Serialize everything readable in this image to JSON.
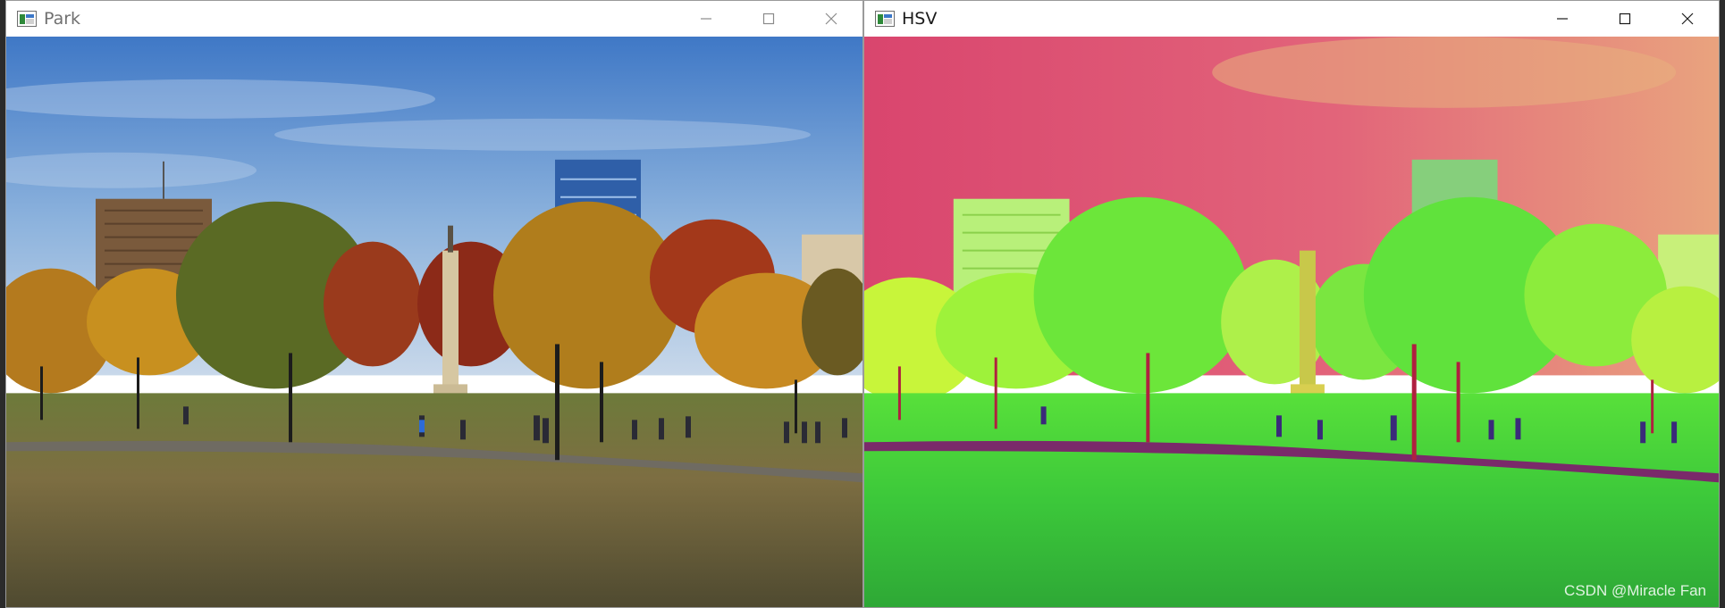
{
  "windows": {
    "park": {
      "title": "Park",
      "image_description_icon": "park-photo"
    },
    "hsv": {
      "title": "HSV",
      "image_description_icon": "hsv-photo"
    }
  },
  "icons": {
    "app": "window-app-icon",
    "minimize": "minimize-icon",
    "maximize": "maximize-icon",
    "close": "close-icon"
  },
  "watermark": "CSDN @Miracle Fan"
}
